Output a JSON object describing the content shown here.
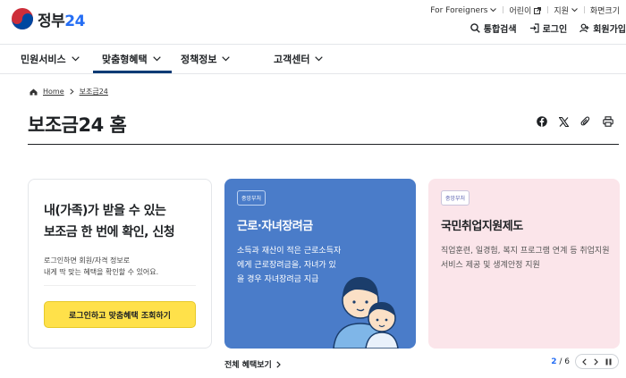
{
  "header": {
    "logo_text": "정부",
    "logo_num": "24",
    "util_links": [
      {
        "label": "For Foreigners"
      },
      {
        "label": "어린이"
      },
      {
        "label": "지원"
      },
      {
        "label": "화면크기"
      }
    ],
    "actions": {
      "search": "통합검색",
      "login": "로그인",
      "join": "회원가입"
    }
  },
  "nav": {
    "items": [
      {
        "label": "민원서비스"
      },
      {
        "label": "맞춤형혜택"
      },
      {
        "label": "정책정보"
      },
      {
        "label": "고객센터"
      }
    ]
  },
  "breadcrumb": {
    "home": "Home",
    "current": "보조금24"
  },
  "page_title": "보조금24 홈",
  "login_card": {
    "heading_line1": "내(가족)가 받을 수 있는",
    "heading_line2": "보조금 한 번에 확인, 신청",
    "desc_line1": "로그인하면 회원/자격 정보로",
    "desc_line2": "내게 딱 맞는 혜택을 확인할 수 있어요.",
    "button": "로그인하고 맞춤혜택 조회하기"
  },
  "cards": [
    {
      "badge": "중앙부처",
      "title": "근로·자녀장려금",
      "desc": "소득과 재산이 적은 근로소득자에게 근로장려금을, 자녀가 있을 경우 자녀장려금 지급"
    },
    {
      "badge": "중앙부처",
      "title": "국민취업지원제도",
      "desc": "직업훈련, 일경험, 복지 프로그램 연계 등 취업지원서비스 제공 및 생계안정 지원"
    }
  ],
  "more_link": "전체 혜택보기",
  "pager": {
    "current": "2",
    "separator": "/",
    "total": "6"
  },
  "colors": {
    "brand_blue": "#256ef4",
    "nav_active": "#063a74",
    "card_blue": "#4a7cc9",
    "card_pink": "#fbe5ea",
    "login_button": "#ffe14a"
  }
}
